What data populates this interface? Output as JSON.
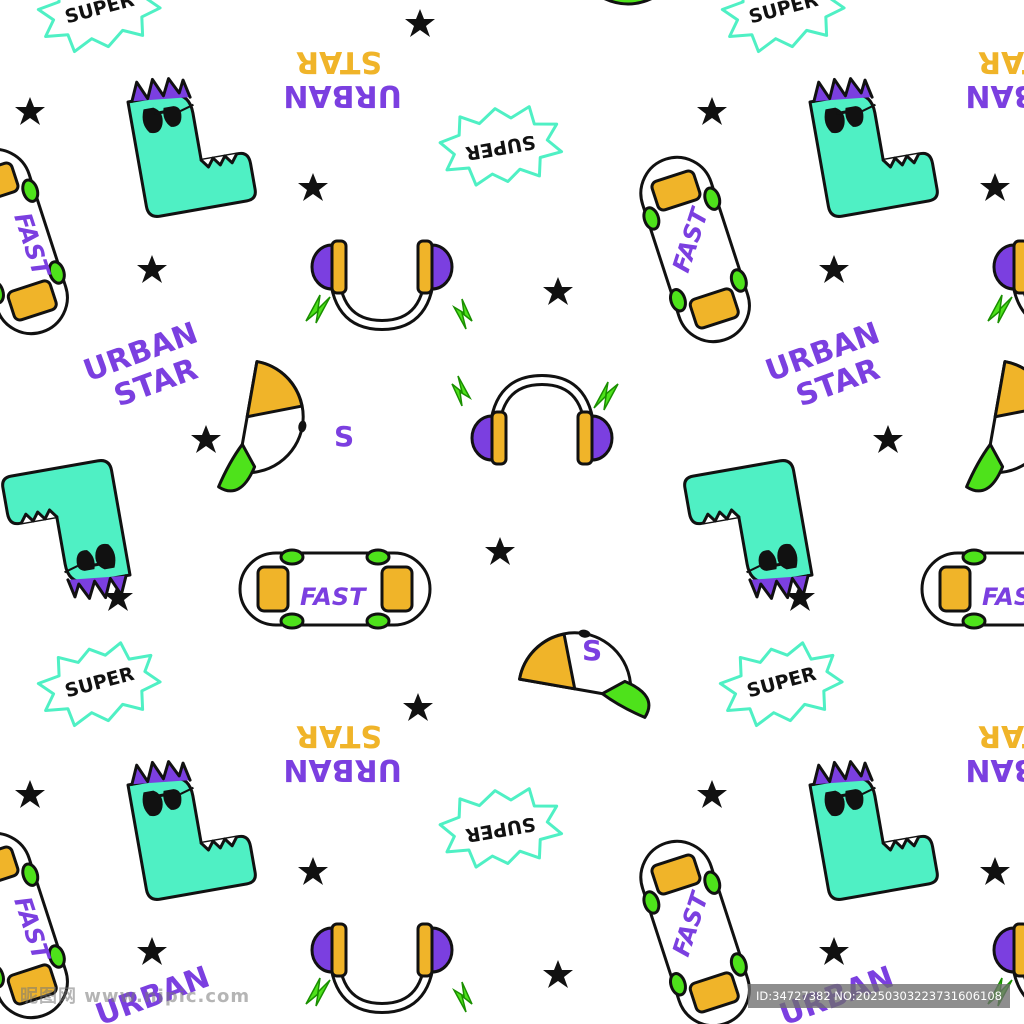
{
  "texts": {
    "urban": "URBAN",
    "star": "STAR",
    "fast": "FAST",
    "super": "SUPER",
    "cap_letter": "S"
  },
  "watermark": {
    "site": "昵图网 www.nipic.com",
    "id": "ID:34727382 NO:20250303223731606108"
  },
  "colors": {
    "teal": "#4ff0c4",
    "purple": "#7b3fe0",
    "yellow": "#f0b429",
    "green": "#4ee21b",
    "black": "#111111",
    "white": "#ffffff"
  }
}
